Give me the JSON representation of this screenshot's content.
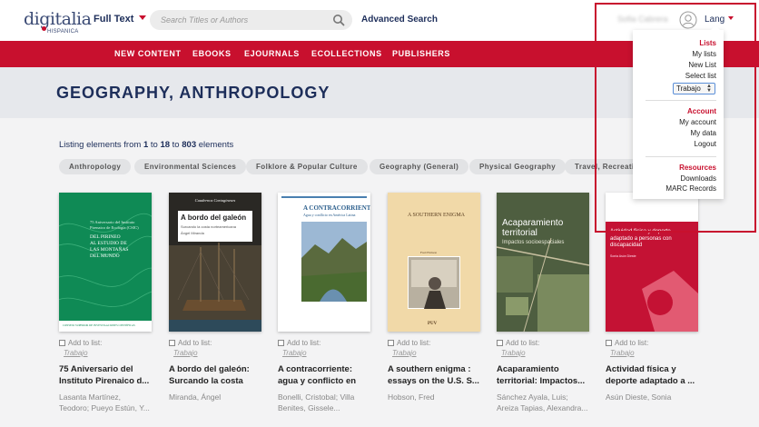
{
  "header": {
    "logo_text": "digitalia",
    "logo_sub": "HISPANICA",
    "search_mode": "Full Text",
    "search_placeholder": "Search Titles or Authors",
    "advanced_search": "Advanced Search",
    "user_name": "Sofia Cabrera",
    "lang_label": "Lang"
  },
  "nav": {
    "items": [
      "NEW CONTENT",
      "EBOOKS",
      "EJOURNALS",
      "ECOLLECTIONS",
      "PUBLISHERS"
    ]
  },
  "banner": {
    "title": "GEOGRAPHY, ANTHROPOLOGY"
  },
  "listing": {
    "prefix": "Listing elements from",
    "from": "1",
    "to_word": "to",
    "to": "18",
    "to_word2": "to",
    "total": "803",
    "suffix": "elements"
  },
  "chips": [
    "Anthropology",
    "Environmental Sciences",
    "Folklore & Popular Culture",
    "Geography (General)",
    "Physical Geography",
    "Travel, Recreation"
  ],
  "book_common": {
    "add_label": "Add to list:",
    "list_name": "Trabajo"
  },
  "books": [
    {
      "title": "75 Aniversario del Instituto Pirenaico d...",
      "author": "Lasanta Martínez, Teodoro; Pueyo Estún, Y...",
      "cover_lines": [
        "75 Aniversario del Instituto",
        "Pirenaico de Ecología (CSIC)",
        "DEL PIRINEO",
        "AL ESTUDIO DE",
        "LAS MONTAÑAS",
        "DEL MUNDO"
      ],
      "cover_footer": "CONSEJO SUPERIOR DE INVESTIGACIONES CIENTÍFICAS"
    },
    {
      "title": "A bordo del galeón: Surcando la costa no...",
      "author": "Miranda, Ángel",
      "cover_series": "Cuadernos Cartagineses",
      "cover_title": "A bordo del galeón",
      "cover_sub": "Surcando la costa norteamericana",
      "cover_author": "Ángel Miranda"
    },
    {
      "title": "A contracorriente: agua y conflicto en A...",
      "author": "Bonelli, Cristobal; Villa Benites, Gissele...",
      "cover_title": "A CONTRACORRIENTE",
      "cover_sub": "Agua y conflicto en América Latina"
    },
    {
      "title": "A southern enigma : essays on the U.S. S...",
      "author": "Hobson, Fred",
      "cover_title": "A SOUTHERN ENIGMA",
      "cover_author": "Fred Hobson",
      "cover_pub": "PUV"
    },
    {
      "title": "Acaparamiento territorial: Impactos...",
      "author": "Sánchez Ayala, Luis; Areiza Tapias, Alexandra...",
      "cover_title": "Acaparamiento territorial",
      "cover_sub": "Impactos socioespaciales"
    },
    {
      "title": "Actividad física y deporte adaptado a ...",
      "author": "Asún Dieste, Sonia",
      "cover_title": "Actividad física y deporte adaptado a personas con discapacidad",
      "cover_author": "Sonia Asún Dieste"
    }
  ],
  "dropdown": {
    "lists_head": "Lists",
    "my_lists": "My lists",
    "new_list": "New List",
    "select_list": "Select list",
    "selected": "Trabajo",
    "account_head": "Account",
    "my_account": "My account",
    "my_data": "My data",
    "logout": "Logout",
    "resources_head": "Resources",
    "downloads": "Downloads",
    "marc": "MARC Records"
  },
  "colors": {
    "brand_red": "#c8102e",
    "navy": "#1d2e5a",
    "background": "#f3f3f4"
  }
}
